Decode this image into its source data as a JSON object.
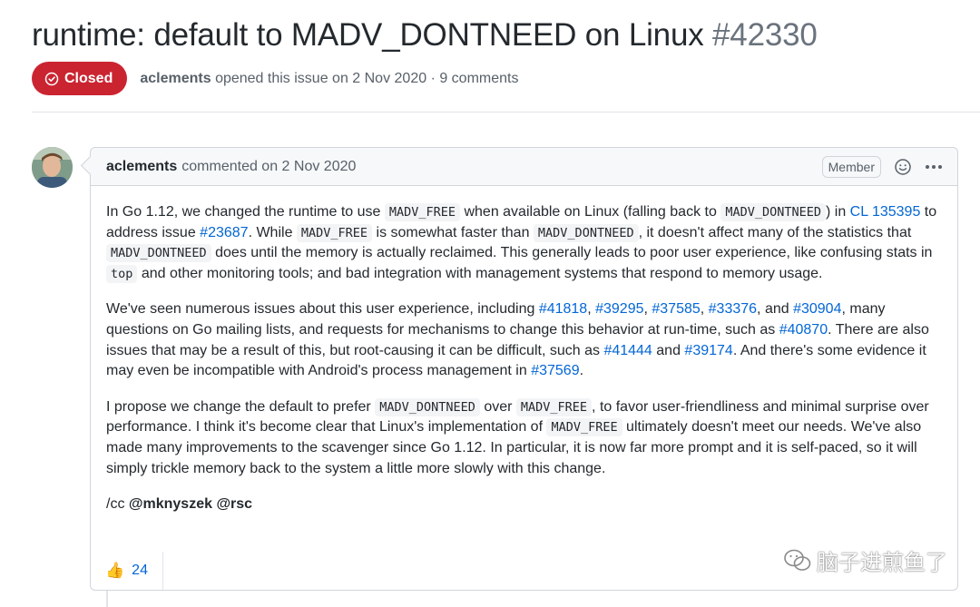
{
  "issue": {
    "title": "runtime: default to MADV_DONTNEED on Linux",
    "number": "#42330",
    "state": "Closed",
    "author": "aclements",
    "meta_text": "opened this issue on 2 Nov 2020 · 9 comments"
  },
  "comment": {
    "author": "aclements",
    "action": "commented on 2 Nov 2020",
    "badge": "Member",
    "reaction_count": "24",
    "reaction_emoji": "👍",
    "paragraphs": [
      [
        {
          "t": "text",
          "v": "In Go 1.12, we changed the runtime to use "
        },
        {
          "t": "code",
          "v": "MADV_FREE"
        },
        {
          "t": "text",
          "v": " when available on Linux (falling back to "
        },
        {
          "t": "code",
          "v": "MADV_DONTNEED"
        },
        {
          "t": "text",
          "v": ") in "
        },
        {
          "t": "link",
          "v": "CL 135395"
        },
        {
          "t": "text",
          "v": " to address issue "
        },
        {
          "t": "link",
          "v": "#23687"
        },
        {
          "t": "text",
          "v": ". While "
        },
        {
          "t": "code",
          "v": "MADV_FREE"
        },
        {
          "t": "text",
          "v": " is somewhat faster than "
        },
        {
          "t": "code",
          "v": "MADV_DONTNEED"
        },
        {
          "t": "text",
          "v": ", it doesn't affect many of the statistics that "
        },
        {
          "t": "code",
          "v": "MADV_DONTNEED"
        },
        {
          "t": "text",
          "v": " does until the memory is actually reclaimed. This generally leads to poor user experience, like confusing stats in "
        },
        {
          "t": "code",
          "v": "top"
        },
        {
          "t": "text",
          "v": " and other monitoring tools; and bad integration with management systems that respond to memory usage."
        }
      ],
      [
        {
          "t": "text",
          "v": "We've seen numerous issues about this user experience, including "
        },
        {
          "t": "link",
          "v": "#41818"
        },
        {
          "t": "text",
          "v": ", "
        },
        {
          "t": "link",
          "v": "#39295"
        },
        {
          "t": "text",
          "v": ", "
        },
        {
          "t": "link",
          "v": "#37585"
        },
        {
          "t": "text",
          "v": ", "
        },
        {
          "t": "link",
          "v": "#33376"
        },
        {
          "t": "text",
          "v": ", and "
        },
        {
          "t": "link",
          "v": "#30904"
        },
        {
          "t": "text",
          "v": ", many questions on Go mailing lists, and requests for mechanisms to change this behavior at run-time, such as "
        },
        {
          "t": "link",
          "v": "#40870"
        },
        {
          "t": "text",
          "v": ". There are also issues that may be a result of this, but root-causing it can be difficult, such as "
        },
        {
          "t": "link",
          "v": "#41444"
        },
        {
          "t": "text",
          "v": " and "
        },
        {
          "t": "link",
          "v": "#39174"
        },
        {
          "t": "text",
          "v": ". And there's some evidence it may even be incompatible with Android's process management in "
        },
        {
          "t": "link",
          "v": "#37569"
        },
        {
          "t": "text",
          "v": "."
        }
      ],
      [
        {
          "t": "text",
          "v": "I propose we change the default to prefer "
        },
        {
          "t": "code",
          "v": "MADV_DONTNEED"
        },
        {
          "t": "text",
          "v": " over "
        },
        {
          "t": "code",
          "v": "MADV_FREE"
        },
        {
          "t": "text",
          "v": ", to favor user-friendliness and minimal surprise over performance. I think it's become clear that Linux's implementation of "
        },
        {
          "t": "code",
          "v": "MADV_FREE"
        },
        {
          "t": "text",
          "v": " ultimately doesn't meet our needs. We've also made many improvements to the scavenger since Go 1.12. In particular, it is now far more prompt and it is self-paced, so it will simply trickle memory back to the system a little more slowly with this change."
        }
      ],
      [
        {
          "t": "text",
          "v": "/cc "
        },
        {
          "t": "mention",
          "v": "@mknyszek"
        },
        {
          "t": "text",
          "v": " "
        },
        {
          "t": "mention",
          "v": "@rsc"
        }
      ]
    ]
  },
  "watermark": "脑子进煎鱼了",
  "colors": {
    "closed_badge": "#cb2431",
    "link": "#0366d6",
    "text": "#24292e",
    "muted": "#586069"
  }
}
